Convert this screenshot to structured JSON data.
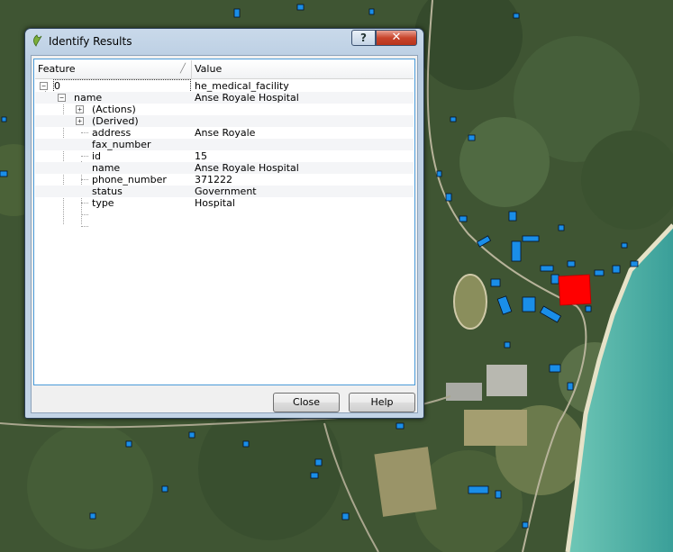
{
  "dialog": {
    "title": "Identify Results",
    "help_button": "?",
    "close_button": "✕",
    "columns": {
      "feature": "Feature",
      "value": "Value"
    },
    "rows": [
      {
        "feature": "0",
        "value": "he_medical_facility"
      },
      {
        "feature": "name",
        "value": "Anse Royale Hospital"
      },
      {
        "feature": "(Actions)",
        "value": ""
      },
      {
        "feature": "(Derived)",
        "value": ""
      },
      {
        "feature": "address",
        "value": "Anse Royale"
      },
      {
        "feature": "fax_number",
        "value": ""
      },
      {
        "feature": "id",
        "value": "15"
      },
      {
        "feature": "name",
        "value": "Anse Royale Hospital"
      },
      {
        "feature": "phone_number",
        "value": "371222"
      },
      {
        "feature": "status",
        "value": "Government"
      },
      {
        "feature": "type",
        "value": "Hospital"
      }
    ],
    "buttons": {
      "close": "Close",
      "help": "Help"
    }
  },
  "map": {
    "highlight_color": "#ff0000",
    "building_color": "#1a8ee8",
    "sea_color": "#4fb5a8"
  }
}
